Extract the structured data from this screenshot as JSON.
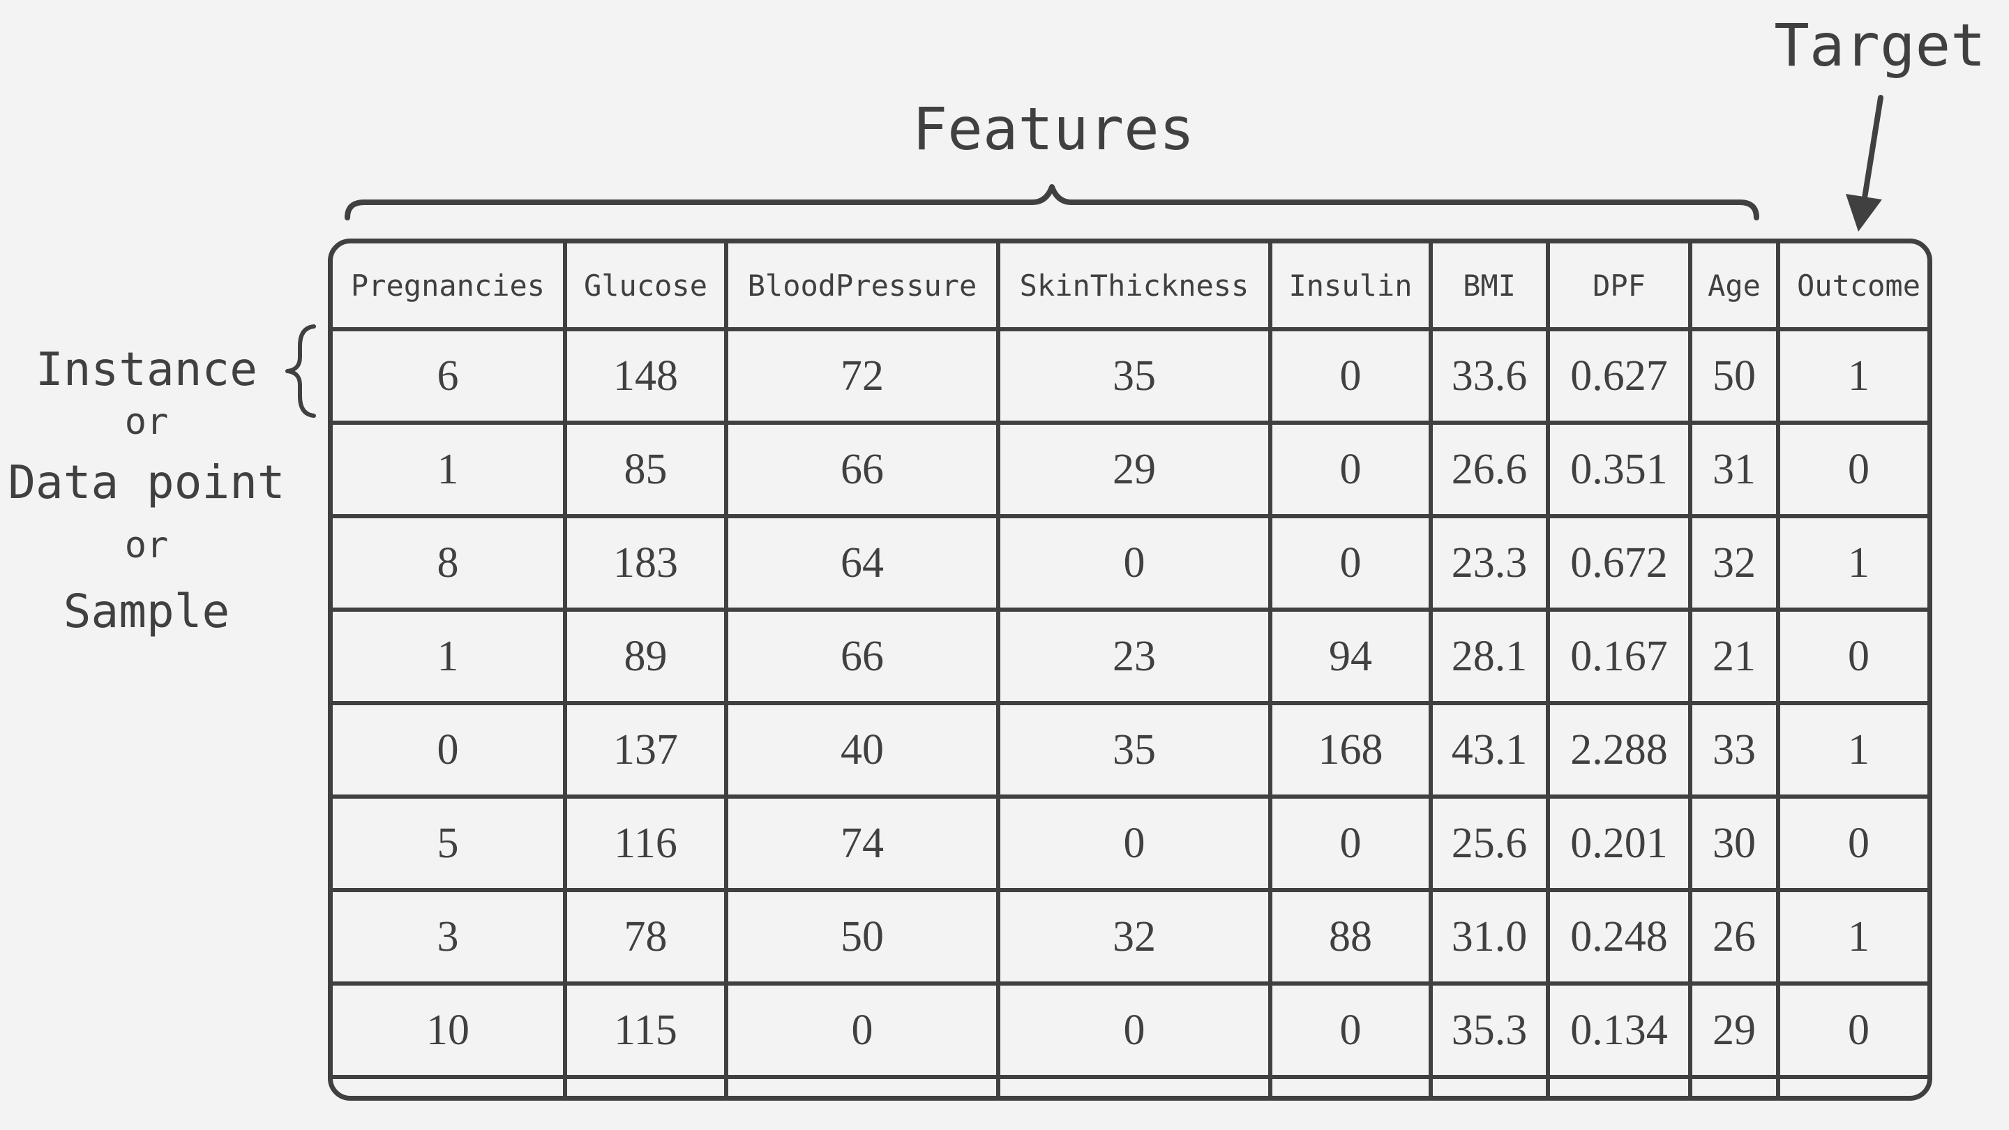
{
  "labels": {
    "features": "Features",
    "target": "Target",
    "instance": "Instance",
    "or_1": "or",
    "data_point": "Data point",
    "or_2": "or",
    "sample": "Sample"
  },
  "table": {
    "columns": [
      "Pregnancies",
      "Glucose",
      "BloodPressure",
      "SkinThickness",
      "Insulin",
      "BMI",
      "DPF",
      "Age",
      "Outcome"
    ],
    "rows": [
      [
        "6",
        "148",
        "72",
        "35",
        "0",
        "33.6",
        "0.627",
        "50",
        "1"
      ],
      [
        "1",
        "85",
        "66",
        "29",
        "0",
        "26.6",
        "0.351",
        "31",
        "0"
      ],
      [
        "8",
        "183",
        "64",
        "0",
        "0",
        "23.3",
        "0.672",
        "32",
        "1"
      ],
      [
        "1",
        "89",
        "66",
        "23",
        "94",
        "28.1",
        "0.167",
        "21",
        "0"
      ],
      [
        "0",
        "137",
        "40",
        "35",
        "168",
        "43.1",
        "2.288",
        "33",
        "1"
      ],
      [
        "5",
        "116",
        "74",
        "0",
        "0",
        "25.6",
        "0.201",
        "30",
        "0"
      ],
      [
        "3",
        "78",
        "50",
        "32",
        "88",
        "31.0",
        "0.248",
        "26",
        "1"
      ],
      [
        "10",
        "115",
        "0",
        "0",
        "0",
        "35.3",
        "0.134",
        "29",
        "0"
      ]
    ],
    "ellipsis": [
      "...",
      "...",
      "...",
      "...",
      "...",
      "...",
      "...",
      "...",
      "..."
    ]
  },
  "colors": {
    "ink": "#404040",
    "background": "#f3f3f3"
  }
}
